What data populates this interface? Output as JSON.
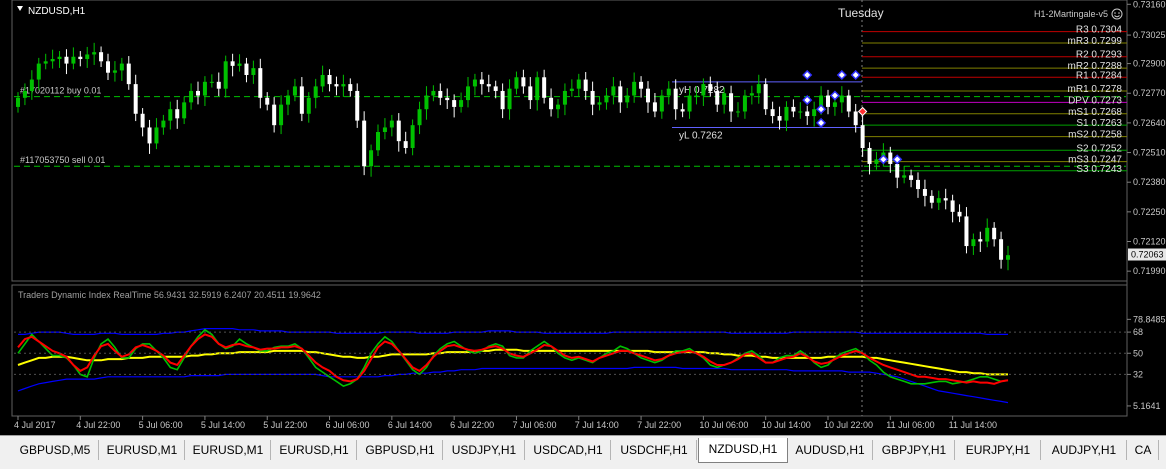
{
  "window": {
    "symbol_label": "NZDUSD,H1",
    "day_label": "Tuesday",
    "ea_label": "H1-2Martingale-v5",
    "ea_status_icon": "smiley-icon"
  },
  "orders": [
    {
      "label": "#17020112 buy 0.01",
      "price": 0.72755
    },
    {
      "label": "#117053750 sell 0.01",
      "price": 0.7245
    }
  ],
  "price_axis": {
    "ticks": [
      "0.73160",
      "0.73025",
      "0.72900",
      "0.72770",
      "0.72640",
      "0.72510",
      "0.72380",
      "0.72250",
      "0.72120",
      "0.71990"
    ],
    "current_price": "0.72063"
  },
  "levels": [
    {
      "label": "R3 0.7304",
      "value": 0.7304,
      "color": "#c00000"
    },
    {
      "label": "mR3 0.7299",
      "value": 0.7299,
      "color": "#808000"
    },
    {
      "label": "R2 0.7293",
      "value": 0.7293,
      "color": "#c00000"
    },
    {
      "label": "mR2 0.7288",
      "value": 0.7288,
      "color": "#808000"
    },
    {
      "label": "R1 0.7284",
      "value": 0.7284,
      "color": "#c00000"
    },
    {
      "label": "mR1 0.7278",
      "value": 0.7278,
      "color": "#808000"
    },
    {
      "label": "DPV 0.7273",
      "value": 0.7273,
      "color": "#c000c0"
    },
    {
      "label": "mS1 0.7268",
      "value": 0.7268,
      "color": "#808000"
    },
    {
      "label": "S1 0.7263",
      "value": 0.7263,
      "color": "#00a000"
    },
    {
      "label": "mS2 0.7258",
      "value": 0.7258,
      "color": "#808000"
    },
    {
      "label": "S2 0.7252",
      "value": 0.7252,
      "color": "#00a000"
    },
    {
      "label": "mS3 0.7247",
      "value": 0.7247,
      "color": "#808000"
    },
    {
      "label": "S3 0.7243",
      "value": 0.7243,
      "color": "#00a000"
    }
  ],
  "yesterday_range": {
    "high_label": "yH 0.7282",
    "high": 0.7282,
    "low_label": "yL 0.7262",
    "low": 0.7262
  },
  "indicator": {
    "title": "Traders Dynamic Index RealTime 56.9431 32.5919 6.2407 20.4511 19.9642",
    "axis_ticks": [
      "78.8485",
      "68",
      "50",
      "32",
      "5.1641"
    ],
    "colors": {
      "price_line": "#ff0000",
      "signal_line": "#00c000",
      "market_base": "#ffff00",
      "bands": "#0000ff"
    }
  },
  "time_axis": [
    "4 Jul 2017",
    "4 Jul 22:00",
    "5 Jul 06:00",
    "5 Jul 14:00",
    "5 Jul 22:00",
    "6 Jul 06:00",
    "6 Jul 14:00",
    "6 Jul 22:00",
    "7 Jul 06:00",
    "7 Jul 14:00",
    "7 Jul 22:00",
    "10 Jul 06:00",
    "10 Jul 14:00",
    "10 Jul 22:00",
    "11 Jul 06:00",
    "11 Jul 14:00"
  ],
  "tabs": [
    {
      "label": "GBPUSD,M5",
      "active": false
    },
    {
      "label": "EURUSD,M1",
      "active": false
    },
    {
      "label": "EURUSD,M1",
      "active": false
    },
    {
      "label": "EURUSD,H1",
      "active": false
    },
    {
      "label": "GBPUSD,H1",
      "active": false
    },
    {
      "label": "USDJPY,H1",
      "active": false
    },
    {
      "label": "USDCAD,H1",
      "active": false
    },
    {
      "label": "USDCHF,H1",
      "active": false
    },
    {
      "label": "NZDUSD,H1",
      "active": true
    },
    {
      "label": "AUDUSD,H1",
      "active": false
    },
    {
      "label": "GBPJPY,H1",
      "active": false
    },
    {
      "label": "EURJPY,H1",
      "active": false
    },
    {
      "label": "AUDJPY,H1",
      "active": false
    },
    {
      "label": "CA",
      "active": false
    }
  ],
  "chart_data": {
    "type": "candlestick",
    "symbol": "NZDUSD",
    "timeframe": "H1",
    "ylim": [
      0.7196,
      0.7317
    ],
    "candle_colors": {
      "up": "#00c000",
      "down": "#ffffff"
    },
    "closes": [
      0.7275,
      0.7278,
      0.7283,
      0.729,
      0.7291,
      0.7292,
      0.7293,
      0.729,
      0.7293,
      0.7292,
      0.7294,
      0.7295,
      0.7291,
      0.7286,
      0.7287,
      0.729,
      0.7281,
      0.7268,
      0.7262,
      0.7255,
      0.7262,
      0.7265,
      0.727,
      0.7266,
      0.7273,
      0.7278,
      0.7276,
      0.7282,
      0.7282,
      0.7279,
      0.7291,
      0.7289,
      0.729,
      0.7285,
      0.7288,
      0.7275,
      0.7272,
      0.7263,
      0.7272,
      0.7276,
      0.728,
      0.7268,
      0.7275,
      0.728,
      0.7285,
      0.7281,
      0.728,
      0.7281,
      0.7278,
      0.7265,
      0.7245,
      0.7252,
      0.726,
      0.7262,
      0.7265,
      0.7256,
      0.7253,
      0.7263,
      0.727,
      0.7276,
      0.7278,
      0.7275,
      0.7274,
      0.7271,
      0.7274,
      0.728,
      0.7283,
      0.7281,
      0.728,
      0.7278,
      0.727,
      0.7279,
      0.7284,
      0.728,
      0.7274,
      0.7284,
      0.7275,
      0.727,
      0.7272,
      0.7278,
      0.7279,
      0.7283,
      0.7278,
      0.7272,
      0.7273,
      0.7276,
      0.728,
      0.7273,
      0.7276,
      0.7282,
      0.7279,
      0.7273,
      0.7269,
      0.7276,
      0.7279,
      0.727,
      0.7269,
      0.7276,
      0.7276,
      0.7281,
      0.7278,
      0.7272,
      0.7277,
      0.7269,
      0.7269,
      0.7276,
      0.7277,
      0.7281,
      0.727,
      0.7267,
      0.7265,
      0.7271,
      0.7269,
      0.7269,
      0.7267,
      0.727,
      0.7276,
      0.7271,
      0.7273,
      0.7276,
      0.7269,
      0.7263,
      0.7253,
      0.7246,
      0.7248,
      0.7251,
      0.7246,
      0.724,
      0.7241,
      0.7239,
      0.7235,
      0.7232,
      0.7229,
      0.7231,
      0.723,
      0.7225,
      0.7223,
      0.721,
      0.7213,
      0.7212,
      0.7218,
      0.7213,
      0.7204,
      0.7206
    ],
    "tdi": {
      "price_line": [
        55,
        62,
        64,
        60,
        56,
        52,
        50,
        47,
        40,
        35,
        38,
        48,
        56,
        58,
        52,
        47,
        49,
        55,
        57,
        55,
        52,
        48,
        42,
        40,
        48,
        56,
        62,
        66,
        64,
        58,
        55,
        57,
        58,
        56,
        55,
        53,
        54,
        54,
        55,
        55,
        56,
        54,
        48,
        42,
        38,
        35,
        30,
        27,
        26,
        28,
        35,
        45,
        55,
        60,
        58,
        52,
        45,
        38,
        35,
        40,
        47,
        52,
        56,
        57,
        55,
        53,
        52,
        53,
        55,
        56,
        54,
        50,
        48,
        47,
        50,
        53,
        57,
        56,
        52,
        48,
        46,
        47,
        45,
        43,
        46,
        48,
        50,
        52,
        52,
        50,
        48,
        46,
        44,
        45,
        48,
        50,
        51,
        52,
        50,
        47,
        43,
        40,
        40,
        42,
        45,
        49,
        50,
        46,
        42,
        42,
        44,
        46,
        47,
        50,
        47,
        43,
        41,
        42,
        45,
        48,
        50,
        52,
        50,
        46,
        43,
        40,
        38,
        36,
        34,
        32,
        30,
        30,
        29,
        28,
        28,
        27,
        26,
        25,
        26,
        25,
        25,
        24,
        26,
        27
      ],
      "signal_line": [
        50,
        58,
        66,
        60,
        54,
        48,
        48,
        46,
        40,
        32,
        30,
        46,
        58,
        62,
        55,
        46,
        46,
        54,
        58,
        58,
        52,
        46,
        38,
        36,
        46,
        56,
        64,
        70,
        66,
        58,
        54,
        56,
        62,
        58,
        55,
        52,
        52,
        55,
        56,
        56,
        58,
        54,
        46,
        38,
        34,
        30,
        26,
        22,
        24,
        28,
        38,
        50,
        58,
        64,
        60,
        52,
        44,
        36,
        32,
        38,
        48,
        54,
        58,
        60,
        56,
        52,
        50,
        52,
        56,
        58,
        56,
        48,
        46,
        46,
        52,
        56,
        60,
        56,
        50,
        46,
        44,
        46,
        44,
        42,
        46,
        50,
        52,
        56,
        54,
        50,
        46,
        44,
        42,
        44,
        48,
        52,
        52,
        54,
        50,
        46,
        40,
        38,
        40,
        42,
        46,
        50,
        52,
        48,
        42,
        42,
        46,
        48,
        48,
        52,
        48,
        42,
        38,
        40,
        46,
        50,
        52,
        54,
        50,
        44,
        40,
        34,
        30,
        28,
        26,
        24,
        24,
        24,
        25,
        26,
        26,
        24,
        25,
        26,
        28,
        30,
        30,
        28,
        26,
        27
      ],
      "market_base": [
        40,
        42,
        44,
        46,
        46,
        47,
        47,
        47,
        46,
        45,
        44,
        44,
        44,
        45,
        45,
        45,
        46,
        46,
        46,
        47,
        47,
        47,
        47,
        47,
        47,
        48,
        48,
        49,
        49,
        50,
        50,
        50,
        51,
        51,
        51,
        51,
        51,
        52,
        52,
        52,
        52,
        52,
        51,
        51,
        50,
        49,
        48,
        47,
        47,
        46,
        46,
        47,
        47,
        48,
        49,
        49,
        49,
        49,
        49,
        49,
        50,
        50,
        51,
        51,
        51,
        51,
        52,
        52,
        52,
        53,
        53,
        53,
        53,
        52,
        52,
        52,
        52,
        52,
        52,
        52,
        52,
        52,
        52,
        52,
        52,
        52,
        52,
        52,
        52,
        52,
        52,
        52,
        51,
        51,
        51,
        51,
        51,
        51,
        51,
        51,
        50,
        50,
        49,
        49,
        48,
        48,
        48,
        47,
        47,
        46,
        46,
        46,
        46,
        46,
        46,
        46,
        46,
        47,
        47,
        47,
        47,
        47,
        47,
        46,
        46,
        45,
        44,
        43,
        42,
        41,
        40,
        39,
        38,
        37,
        36,
        35,
        34,
        34,
        33,
        33,
        32,
        32,
        32,
        32
      ],
      "upper_band": [
        66,
        66,
        67,
        68,
        68,
        68,
        68,
        67,
        66,
        66,
        66,
        66,
        67,
        67,
        67,
        66,
        66,
        66,
        66,
        66,
        66,
        67,
        67,
        68,
        68,
        69,
        70,
        71,
        71,
        71,
        71,
        71,
        70,
        70,
        70,
        69,
        69,
        69,
        69,
        68,
        68,
        68,
        68,
        68,
        68,
        68,
        67,
        67,
        67,
        67,
        67,
        67,
        67,
        68,
        68,
        68,
        68,
        68,
        67,
        67,
        67,
        67,
        67,
        68,
        68,
        68,
        68,
        68,
        69,
        69,
        69,
        69,
        68,
        68,
        68,
        68,
        67,
        67,
        67,
        67,
        67,
        67,
        67,
        67,
        67,
        67,
        68,
        68,
        68,
        68,
        68,
        68,
        68,
        68,
        68,
        68,
        68,
        68,
        68,
        68,
        68,
        68,
        68,
        67,
        67,
        67,
        67,
        67,
        67,
        67,
        67,
        67,
        68,
        68,
        68,
        68,
        68,
        68,
        68,
        68,
        68,
        68,
        67,
        67,
        67,
        67,
        67,
        67,
        67,
        67,
        67,
        67,
        67,
        67,
        67,
        67,
        67,
        67,
        67,
        67,
        66,
        66,
        66,
        66
      ],
      "lower_band": [
        18,
        20,
        22,
        24,
        25,
        26,
        27,
        28,
        28,
        28,
        28,
        28,
        29,
        30,
        30,
        30,
        30,
        30,
        30,
        30,
        30,
        30,
        30,
        30,
        30,
        31,
        31,
        31,
        31,
        31,
        32,
        32,
        32,
        32,
        32,
        32,
        32,
        32,
        32,
        32,
        32,
        32,
        32,
        32,
        31,
        30,
        30,
        30,
        30,
        30,
        30,
        30,
        30,
        31,
        31,
        32,
        32,
        33,
        33,
        33,
        34,
        34,
        35,
        35,
        36,
        36,
        36,
        37,
        37,
        37,
        37,
        37,
        37,
        37,
        37,
        37,
        37,
        37,
        37,
        37,
        37,
        37,
        37,
        37,
        37,
        37,
        37,
        37,
        37,
        38,
        38,
        38,
        38,
        38,
        38,
        38,
        37,
        37,
        37,
        37,
        37,
        37,
        37,
        36,
        36,
        36,
        36,
        36,
        36,
        36,
        36,
        36,
        35,
        35,
        35,
        35,
        35,
        35,
        35,
        35,
        34,
        34,
        34,
        34,
        33,
        32,
        31,
        30,
        28,
        26,
        24,
        22,
        20,
        18,
        17,
        16,
        15,
        14,
        13,
        12,
        11,
        10,
        9,
        8
      ]
    }
  }
}
